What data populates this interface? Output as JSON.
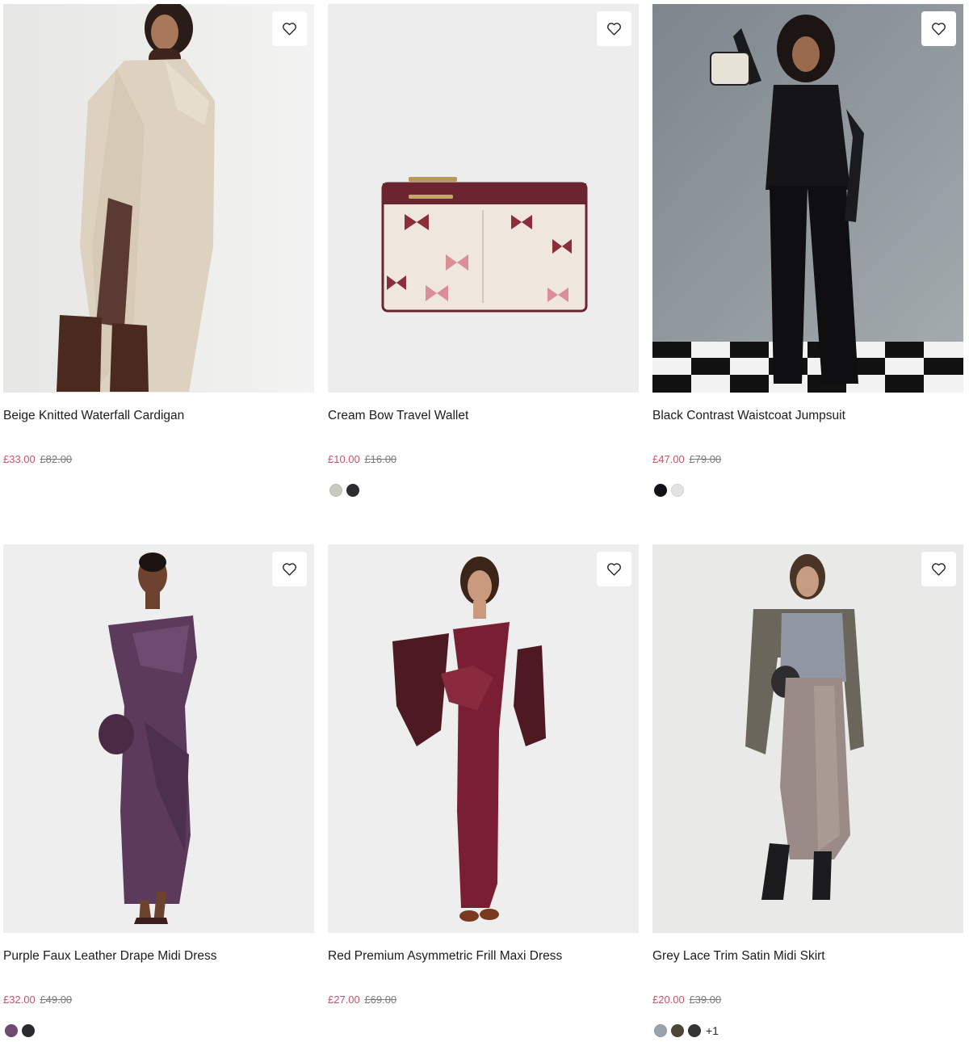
{
  "products": [
    {
      "title": "Beige Knitted Waterfall Cardigan",
      "price_now": "£33.00",
      "price_was": "£82.00",
      "image_bg": "#efefee",
      "swatches": []
    },
    {
      "title": "Cream Bow Travel Wallet",
      "price_now": "£10.00",
      "price_was": "£16.00",
      "image_bg": "#ededed",
      "swatches": [
        "#c9c9bf",
        "#2e2e30"
      ]
    },
    {
      "title": "Black Contrast Waistcoat Jumpsuit",
      "price_now": "£47.00",
      "price_was": "£79.00",
      "image_bg": "#8d969c",
      "swatches": [
        "#111318",
        "#e3e3e3"
      ]
    },
    {
      "title": "Purple Faux Leather Drape Midi Dress",
      "price_now": "£32.00",
      "price_was": "£49.00",
      "image_bg": "#eeeeee",
      "swatches": [
        "#6e4a70",
        "#2a2b2e"
      ]
    },
    {
      "title": "Red Premium Asymmetric Frill Maxi Dress",
      "price_now": "£27.00",
      "price_was": "£69.00",
      "image_bg": "#eeeeee",
      "swatches": []
    },
    {
      "title": "Grey Lace Trim Satin Midi Skirt",
      "price_now": "£20.00",
      "price_was": "£39.00",
      "image_bg": "#e9e9e8",
      "swatches": [
        "#9aa3ad",
        "#4b4638",
        "#333436"
      ],
      "more_colours": "+1"
    }
  ],
  "icons": {
    "wishlist": "heart-outline-icon"
  },
  "colors": {
    "sale_price": "#c8536a",
    "was_price": "#7a7a7a"
  }
}
